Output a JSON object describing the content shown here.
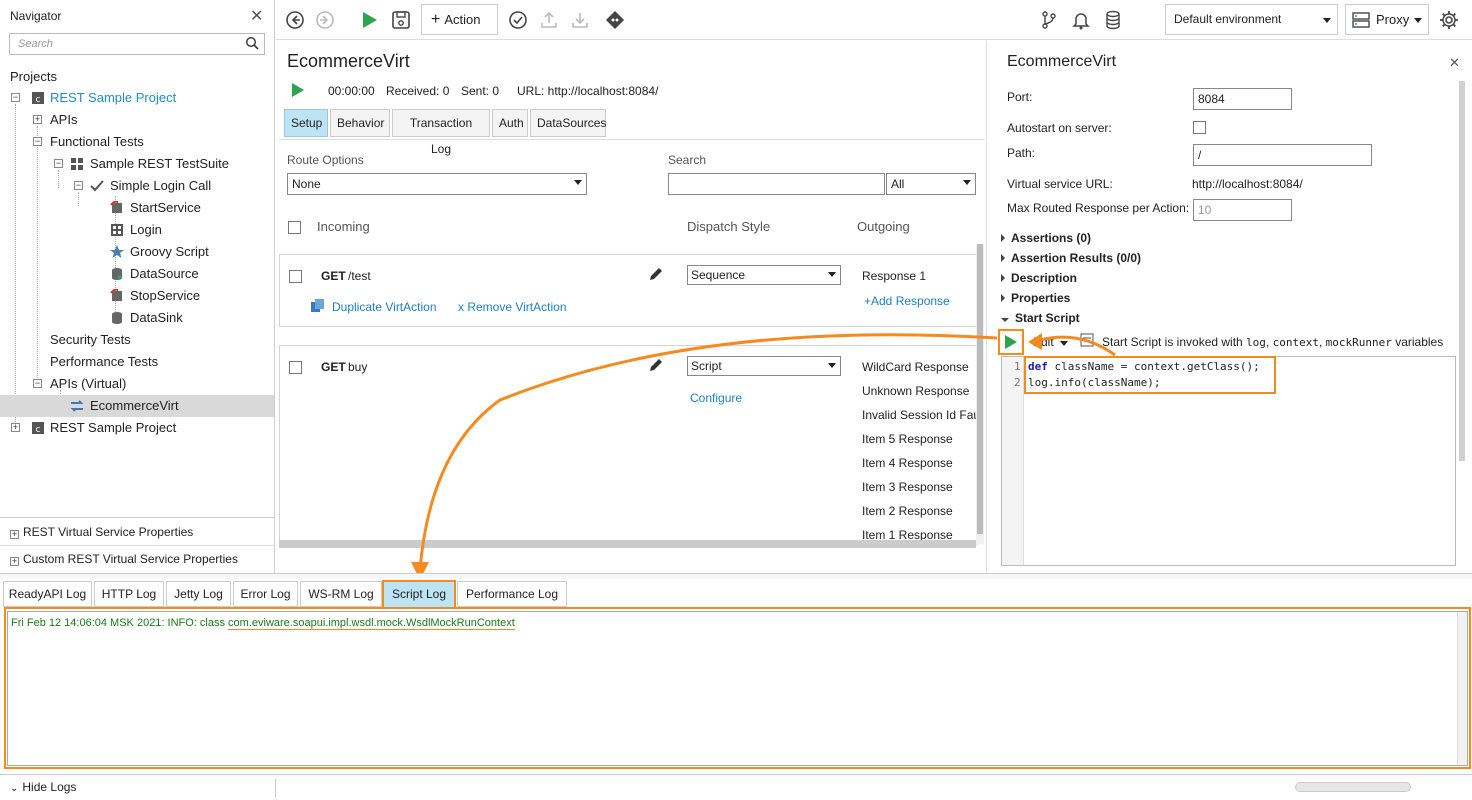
{
  "navigator": {
    "title": "Navigator",
    "search_placeholder": "Search",
    "projects_label": "Projects",
    "tree": {
      "project1": "REST Sample Project",
      "apis": "APIs",
      "functional_tests": "Functional Tests",
      "testsuite": "Sample REST TestSuite",
      "testcase": "Simple Login Call",
      "steps": [
        "StartService",
        "Login",
        "Groovy Script",
        "DataSource",
        "StopService",
        "DataSink"
      ],
      "security_tests": "Security Tests",
      "performance_tests": "Performance Tests",
      "apis_virtual": "APIs (Virtual)",
      "virt": "EcommerceVirt",
      "project2": "REST Sample Project"
    },
    "properties": [
      "REST Virtual Service Properties",
      "Custom REST Virtual Service Properties"
    ]
  },
  "toolbar": {
    "action_label": "Action",
    "environment": "Default environment",
    "proxy_label": "Proxy"
  },
  "editor": {
    "title": "EcommerceVirt",
    "timer": "00:00:00",
    "received": "Received: 0",
    "sent": "Sent: 0",
    "url": "URL: http://localhost:8084/",
    "tabs": [
      "Setup",
      "Behavior",
      "Transaction Log",
      "Auth",
      "DataSources"
    ],
    "route_options_label": "Route Options",
    "route_options_value": "None",
    "search_label": "Search",
    "search_scope": "All",
    "columns": {
      "incoming": "Incoming",
      "dispatch": "Dispatch Style",
      "outgoing": "Outgoing"
    },
    "actions": [
      {
        "method": "GET",
        "path": "/test",
        "dispatch": "Sequence",
        "outgoing": [
          "Response 1"
        ],
        "add_response": "+Add Response",
        "duplicate": "Duplicate VirtAction",
        "remove": "x Remove VirtAction"
      },
      {
        "method": "GET",
        "path": "buy",
        "dispatch": "Script",
        "configure": "Configure",
        "outgoing": [
          "WildCard Response",
          "Unknown Response",
          "Invalid Session Id Faul",
          "Item 5 Response",
          "Item 4 Response",
          "Item 3 Response",
          "Item 2 Response",
          "Item 1 Response"
        ]
      }
    ]
  },
  "props_panel": {
    "title": "EcommerceVirt",
    "port_label": "Port:",
    "port_value": "8084",
    "autostart_label": "Autostart on server:",
    "path_label": "Path:",
    "path_value": "/",
    "url_label": "Virtual service URL:",
    "url_value": "http://localhost:8084/",
    "max_label": "Max Routed Response per Action:",
    "max_value": "10",
    "sections": [
      "Assertions (0)",
      "Assertion Results (0/0)",
      "Description",
      "Properties"
    ],
    "start_script": "Start Script",
    "edit_label": "Edit",
    "script_hint_prefix": "Start Script is invoked with ",
    "script_hint_vars": [
      "log",
      "context",
      "mockRunner"
    ],
    "script_hint_suffix": " variables",
    "code_lines": [
      {
        "num": "1",
        "kw": "def",
        "text": " className = context.getClass();"
      },
      {
        "num": "2",
        "kw": "",
        "text": "log.info(className);"
      }
    ]
  },
  "logs": {
    "tabs": [
      "ReadyAPI Log",
      "HTTP Log",
      "Jetty Log",
      "Error Log",
      "WS-RM Log",
      "Script Log",
      "Performance Log"
    ],
    "active_tab": "Script Log",
    "entry_prefix": "Fri Feb 12 14:06:04 MSK 2021: INFO: class ",
    "entry_class": "com.eviware.soapui.impl.wsdl.mock.WsdlMockRunContext",
    "hide_logs": "Hide Logs"
  },
  "colors": {
    "accent": "#1f8fc0",
    "highlight": "#f58a1f",
    "run_green": "#2ea44f",
    "tab_active": "#bde4f5"
  }
}
